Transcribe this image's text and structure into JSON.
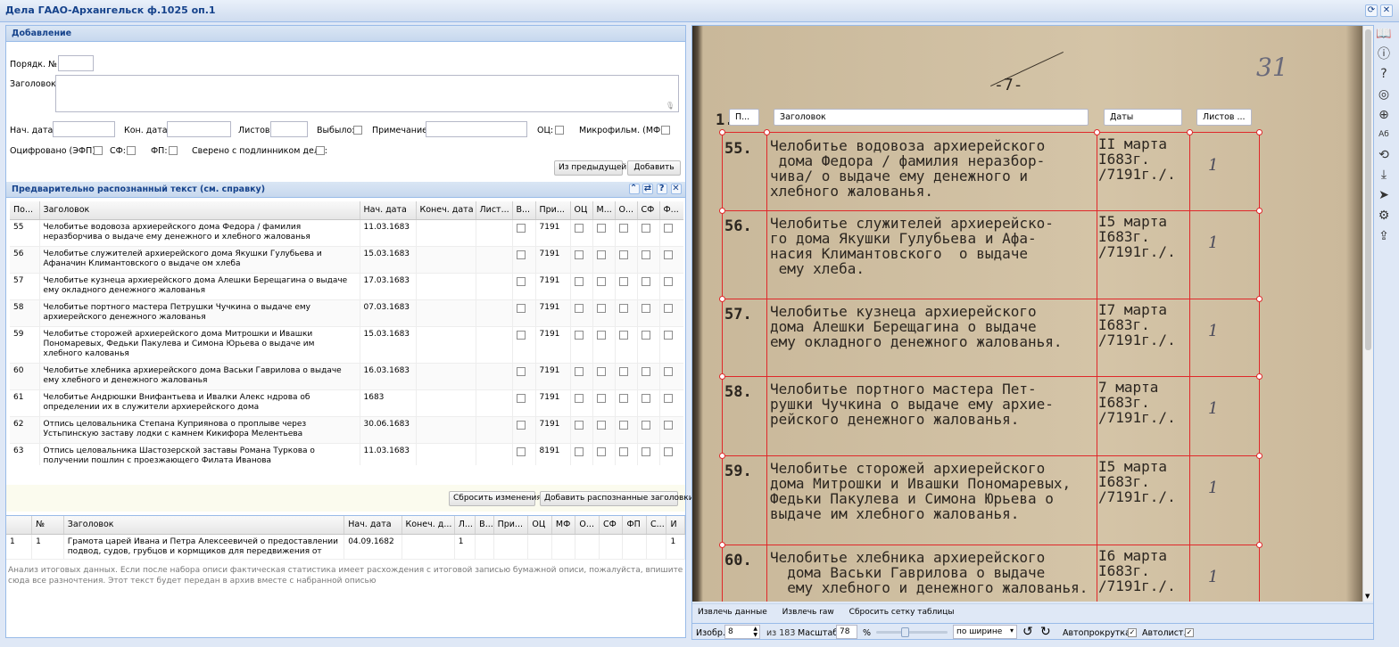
{
  "window": {
    "title": "Дела ГААО-Архангельск ф.1025 оп.1"
  },
  "add_panel": {
    "title": "Добавление",
    "order_label": "Порядк. №:",
    "heading_label": "Заголовок:",
    "start_date_label": "Нач. дата:",
    "end_date_label": "Кон. дата:",
    "sheets_label": "Листов:",
    "removed_label": "Выбыло:",
    "note_label": "Примечание:",
    "oc_label": "ОЦ:",
    "microfilm_label": "Микрофильм. (МФ):",
    "digitized_label": "Оцифровано (ЭФП):",
    "sf_label": "СФ:",
    "fp_label": "ФП:",
    "checked_label": "Сверено с подлинником дела:",
    "from_prev_button": "Из предыдущей",
    "add_button": "Добавить"
  },
  "ocr_panel": {
    "title": "Предварительно распознанный текст (см. справку)",
    "columns": [
      "По...",
      "Заголовок",
      "Нач. дата",
      "Конеч. дата",
      "Лист...",
      "В...",
      "При...",
      "ОЦ",
      "М...",
      "О...",
      "СФ",
      "Ф..."
    ],
    "rows": [
      {
        "n": "55",
        "title": "Челобитье водовоза архиерейского дома Федора / фамилия неразборчива о выдаче ему денежного и хлебного жалованья",
        "date": "11.03.1683",
        "note": "7191"
      },
      {
        "n": "56",
        "title": "Челобитье служителей архиерейского дома Якушки Гулубьева и Афаначин Климантовского о выдаче ом хлеба",
        "date": "15.03.1683",
        "note": "7191"
      },
      {
        "n": "57",
        "title": "Челобитье кузнеца архиерейского дома Алешки Берещагина о выдаче ему окладного денежного жалованья",
        "date": "17.03.1683",
        "note": "7191"
      },
      {
        "n": "58",
        "title": "Челобитье портного мастера Петрушки Чучкина о выдаче ему архиерейского денежного жалованья",
        "date": "07.03.1683",
        "note": "7191"
      },
      {
        "n": "59",
        "title": "Челобитье сторожей архиерейского дома Митрошки и Ивашки Пономаревых, Федьки Пакулева и Симона Юрьева о выдаче им хлебного калованья",
        "date": "15.03.1683",
        "note": "7191"
      },
      {
        "n": "60",
        "title": "Челобитье хлебника архиерейского дома Васьки Гаврилова о выдаче ему хлебного и денежного жалованья",
        "date": "16.03.1683",
        "note": "7191"
      },
      {
        "n": "61",
        "title": "Челобитье Андрюшки Внифантьева и Ивалки Алекс ндрова об определении их в служители архиерейского дома",
        "date": "1683",
        "note": "7191"
      },
      {
        "n": "62",
        "title": "Отпись целовальника Степана Куприянова о проплыве через Устьпинскую заставу лодки с камнем Кикифора Мелентьева",
        "date": "30.06.1683",
        "note": "7191"
      },
      {
        "n": "63",
        "title": "Отпись целовальника Шастозерской заставы Романа Туркова о получении пошлин с проезжающего Филата Иванова",
        "date": "11.03.1683",
        "note": "8191"
      }
    ],
    "reset_button": "Сбросить изменения",
    "add_recognized_button": "Добавить распознанные заголовки"
  },
  "bottom_grid": {
    "columns": [
      "",
      "№",
      "Заголовок",
      "Нач. дата",
      "Конеч. д...",
      "Л...",
      "В...",
      "При...",
      "ОЦ",
      "МФ",
      "О...",
      "СФ",
      "ФП",
      "С...",
      "И"
    ],
    "rows": [
      {
        "idx": "1",
        "n": "1",
        "title": "Грамота царей Ивана и Петра Алексеевичей о предоставлении подвод, судов, грубцов и кормщиков для передвижения от",
        "date": "04.09.1682",
        "sheets": "1",
        "extra": "1"
      }
    ]
  },
  "summary": {
    "placeholder": "Анализ итоговых данных. Если после набора описи фактическая статистика имеет расхождения с итоговой записью бумажной описи, пожалуйста, впишите сюда все разночтения. Этот текст будет передан в архив вместе с набранной описью"
  },
  "viewer": {
    "grid_headers": [
      "П...",
      "Заголовок",
      "Даты",
      "Листов ..."
    ],
    "scan_top_mark": "-7-",
    "scan_page_num": "31",
    "scan_col_marker": "1.",
    "entries": [
      {
        "num": "55.",
        "text": "Челобитье водовоза архиерейского\n дома Федора / фамилия неразбор-\nчива/ о выдаче ему денежного и\nхлебного жалованья.",
        "date": "II марта\nI683г.\n/7191г./.",
        "sheets": "1"
      },
      {
        "num": "56.",
        "text": "Челобитье служителей архиерейско-\nго дома Якушки Гулубьева и Афа-\nнасия Климантовского  о выдаче\n ему хлеба.",
        "date": "I5 марта\nI683г.\n/7191г./.",
        "sheets": "1"
      },
      {
        "num": "57.",
        "text": "Челобитье кузнеца архиерейского\nдома Алешки Берещагина о выдаче\nему окладного денежного жалованья.",
        "date": "I7 марта\nI683г.\n/7191г./.",
        "sheets": "1"
      },
      {
        "num": "58.",
        "text": "Челобитье портного мастера Пет-\nрушки Чучкина о выдаче ему архие-\nрейского денежного жалованья.",
        "date": "7 марта\nI683г.\n/7191г./.",
        "sheets": "1"
      },
      {
        "num": "59.",
        "text": "Челобитье сторожей архиерейского\nдома Митрошки и Ивашки Пономаревых,\nФедьки Пакулева и Симона Юрьева о\nвыдаче им хлебного жалованья.",
        "date": "I5 марта\nI683г.\n/7191г./.",
        "sheets": "1"
      },
      {
        "num": "60.",
        "text": "Челобитье хлебника архиерейского\n  дома Васьки Гаврилова о выдаче\n  ему хлебного и денежного жалованья.",
        "date": "I6 марта\nI683г.\n/7191г./.",
        "sheets": "1"
      }
    ],
    "toolbar": {
      "extract_data": "Извлечь данные",
      "extract_raw": "Извлечь raw",
      "reset_grid": "Сбросить сетку таблицы"
    },
    "statusbar": {
      "image_label": "Изобр.",
      "image_value": "8",
      "of_total": "из 183",
      "scale_label": "Масштаб:",
      "scale_value": "78",
      "percent": "%",
      "fit_option": "по ширине",
      "autoscroll_label": "Автопрокрутка:",
      "autolist_label": "Автолист.:"
    }
  },
  "icons": [
    "book-icon",
    "info-icon",
    "help-icon",
    "badge-icon",
    "globe-icon",
    "keyboard-layout-icon",
    "rotate-icon",
    "download-icon",
    "send-icon",
    "settings-icon",
    "export-icon"
  ]
}
